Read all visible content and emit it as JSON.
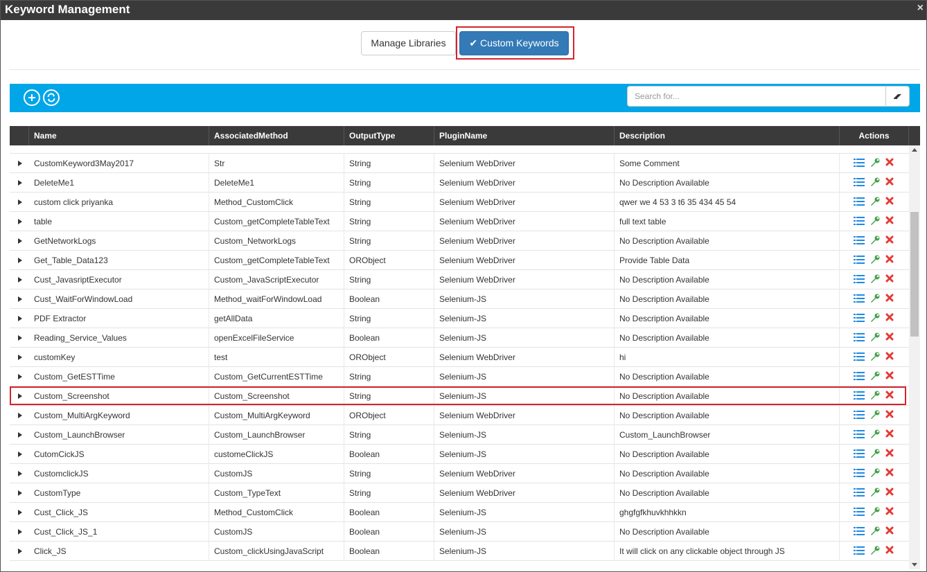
{
  "window": {
    "title": "Keyword Management",
    "close": "×"
  },
  "tabs": {
    "manage_libraries": "Manage Libraries",
    "custom_keywords": "Custom Keywords"
  },
  "search": {
    "placeholder": "Search for..."
  },
  "colors": {
    "accent": "#00a6e8",
    "primary": "#337ab7",
    "header": "#3a3a3a",
    "highlight": "#d6232b",
    "list_icon": "#1e88e5",
    "edit_icon": "#43a047",
    "delete_icon": "#e53935"
  },
  "table": {
    "headers": [
      "Name",
      "AssociatedMethod",
      "OutputType",
      "PluginName",
      "Description",
      "Actions"
    ],
    "rows": [
      [
        "CustomKeyword3May2017",
        "Str",
        "String",
        "Selenium WebDriver",
        "Some Comment"
      ],
      [
        "DeleteMe1",
        "DeleteMe1",
        "String",
        "Selenium WebDriver",
        "No Description Available"
      ],
      [
        "custom click priyanka",
        "Method_CustomClick",
        "String",
        "Selenium WebDriver",
        "qwer we 4 53 3 t6 35 434 45 54"
      ],
      [
        "table",
        "Custom_getCompleteTableText",
        "String",
        "Selenium WebDriver",
        "full text table"
      ],
      [
        "GetNetworkLogs",
        "Custom_NetworkLogs",
        "String",
        "Selenium WebDriver",
        "No Description Available"
      ],
      [
        "Get_Table_Data123",
        "Custom_getCompleteTableText",
        "ORObject",
        "Selenium WebDriver",
        "Provide Table Data"
      ],
      [
        "Cust_JavasriptExecutor",
        "Custom_JavaScriptExecutor",
        "String",
        "Selenium WebDriver",
        "No Description Available"
      ],
      [
        "Cust_WaitForWindowLoad",
        "Method_waitForWindowLoad",
        "Boolean",
        "Selenium-JS",
        "No Description Available"
      ],
      [
        "PDF Extractor",
        "getAllData",
        "String",
        "Selenium-JS",
        "No Description Available"
      ],
      [
        "Reading_Service_Values",
        "openExcelFileService",
        "Boolean",
        "Selenium-JS",
        "No Description Available"
      ],
      [
        "customKey",
        "test",
        "ORObject",
        "Selenium WebDriver",
        "hi"
      ],
      [
        "Custom_GetESTTime",
        "Custom_GetCurrentESTTime",
        "String",
        "Selenium-JS",
        "No Description Available"
      ],
      [
        "Custom_Screenshot",
        "Custom_Screenshot",
        "String",
        "Selenium-JS",
        "No Description Available"
      ],
      [
        "Custom_MultiArgKeyword",
        "Custom_MultiArgKeyword",
        "ORObject",
        "Selenium WebDriver",
        "No Description Available"
      ],
      [
        "Custom_LaunchBrowser",
        "Custom_LaunchBrowser",
        "String",
        "Selenium-JS",
        "Custom_LaunchBrowser"
      ],
      [
        "CutomCickJS",
        "customeClickJS",
        "Boolean",
        "Selenium-JS",
        "No Description Available"
      ],
      [
        "CustomclickJS",
        "CustomJS",
        "String",
        "Selenium WebDriver",
        "No Description Available"
      ],
      [
        "CustomType",
        "Custom_TypeText",
        "String",
        "Selenium WebDriver",
        "No Description Available"
      ],
      [
        "Cust_Click_JS",
        "Method_CustomClick",
        "Boolean",
        "Selenium-JS",
        "ghgfgfkhuvkhhkkn"
      ],
      [
        "Cust_Click_JS_1",
        "CustomJS",
        "Boolean",
        "Selenium-JS",
        "No Description Available"
      ],
      [
        "Click_JS",
        "Custom_clickUsingJavaScript",
        "Boolean",
        "Selenium-JS",
        "It will click on any clickable object through JS"
      ]
    ],
    "highlighted_row": "Custom_Screenshot"
  }
}
